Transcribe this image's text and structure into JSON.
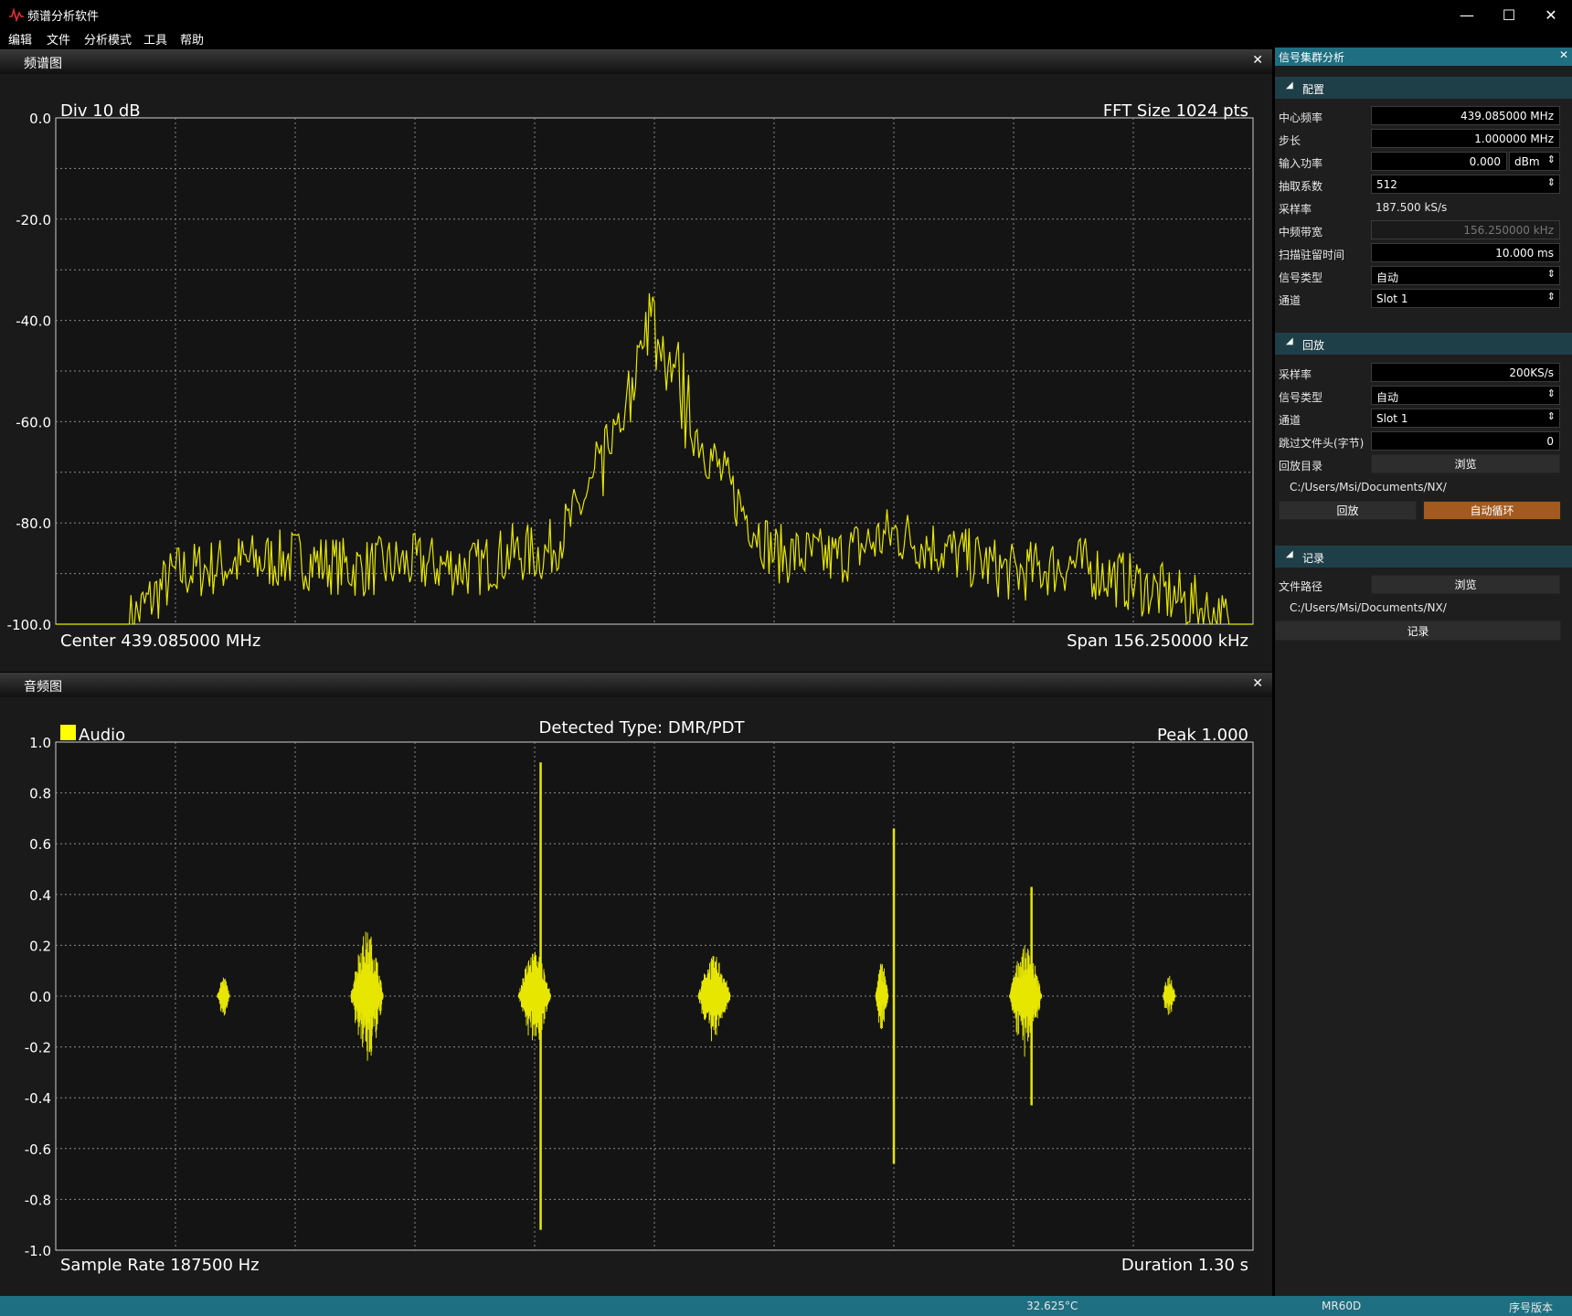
{
  "window": {
    "title": "频谱分析软件",
    "accent": "#1d6f81"
  },
  "menu": [
    "编辑",
    "文件",
    "分析模式",
    "工具",
    "帮助"
  ],
  "spectrum_panel": {
    "title": "频谱图",
    "div_label": "Div 10 dB",
    "fft_label": "FFT Size 1024 pts",
    "center_label": "Center 439.085000 MHz",
    "span_label": "Span 156.250000 kHz",
    "y_ticks": [
      "0.0",
      "-20.0",
      "-40.0",
      "-60.0",
      "-80.0",
      "-100.0"
    ]
  },
  "audio_panel": {
    "title": "音频图",
    "legend": "Audio",
    "detected": "Detected Type: DMR/PDT",
    "peak_label": "Peak 1.000",
    "sample_rate_label": "Sample Rate 187500 Hz",
    "duration_label": "Duration 1.30 s",
    "y_ticks": [
      "1.0",
      "0.8",
      "0.6",
      "0.4",
      "0.2",
      "0.0",
      "-0.2",
      "-0.4",
      "-0.6",
      "-0.8",
      "-1.0"
    ]
  },
  "chart_data": [
    {
      "type": "line",
      "xlabel": "",
      "ylabel": "",
      "ylim": [
        -100,
        0
      ],
      "grid": true,
      "trace_color": "#e6e600",
      "x_norm": [
        0.0,
        0.06,
        0.1,
        0.15,
        0.2,
        0.25,
        0.3,
        0.35,
        0.38,
        0.41,
        0.43,
        0.45,
        0.47,
        0.48,
        0.49,
        0.5,
        0.51,
        0.52,
        0.53,
        0.55,
        0.57,
        0.6,
        0.65,
        0.7,
        0.75,
        0.8,
        0.85,
        0.9,
        0.95,
        0.98,
        1.0
      ],
      "values": [
        -100,
        -100,
        -90,
        -88,
        -87,
        -89,
        -88,
        -89,
        -86,
        -86,
        -80,
        -72,
        -62,
        -54,
        -42,
        -40,
        -50,
        -52,
        -60,
        -68,
        -76,
        -86,
        -87,
        -82,
        -86,
        -90,
        -88,
        -92,
        -96,
        -100,
        -100
      ]
    },
    {
      "type": "line",
      "xlabel": "",
      "ylabel": "",
      "ylim": [
        -1.0,
        1.0
      ],
      "grid": true,
      "trace_color": "#e6e600",
      "bursts": [
        {
          "t": 0.14,
          "amp": 0.08
        },
        {
          "t": 0.26,
          "amp": 0.26
        },
        {
          "t": 0.4,
          "amp": 0.18
        },
        {
          "t": 0.405,
          "amp": 0.92
        },
        {
          "t": 0.55,
          "amp": 0.16
        },
        {
          "t": 0.69,
          "amp": 0.14
        },
        {
          "t": 0.7,
          "amp": 0.66
        },
        {
          "t": 0.81,
          "amp": 0.2
        },
        {
          "t": 0.815,
          "amp": 0.43
        },
        {
          "t": 0.93,
          "amp": 0.09
        }
      ]
    }
  ],
  "dock": {
    "title": "信号集群分析",
    "config": {
      "header": "配置",
      "rows": [
        {
          "label": "中心频率",
          "value": "439.085000 MHz"
        },
        {
          "label": "步长",
          "value": "1.000000 MHz"
        },
        {
          "label": "输入功率",
          "value": "0.000",
          "unit": "dBm"
        },
        {
          "label": "抽取系数",
          "value": "512"
        },
        {
          "label": "采样率",
          "value": "187.500 kS/s"
        },
        {
          "label": "中频带宽",
          "value": "156.250000 kHz"
        },
        {
          "label": "扫描驻留时间",
          "value": "10.000 ms"
        },
        {
          "label": "信号类型",
          "value": "自动"
        },
        {
          "label": "通道",
          "value": "Slot 1"
        }
      ]
    },
    "playback": {
      "header": "回放",
      "rows": [
        {
          "label": "采样率",
          "value": "200KS/s"
        },
        {
          "label": "信号类型",
          "value": "自动"
        },
        {
          "label": "通道",
          "value": "Slot 1"
        },
        {
          "label": "跳过文件头(字节)",
          "value": "0"
        },
        {
          "label": "回放目录",
          "value": "浏览"
        }
      ],
      "path": "C:/Users/Msi/Documents/NX/",
      "play_button": "回放",
      "loop_button": "自动循环",
      "loop_color": "#a25a1e"
    },
    "record": {
      "header": "记录",
      "file_label": "文件路径",
      "browse": "浏览",
      "path": "C:/Users/Msi/Documents/NX/",
      "button": "记录"
    }
  },
  "status": {
    "temp": "32.625°C",
    "model": "MR60D",
    "serial": "序号版本"
  }
}
